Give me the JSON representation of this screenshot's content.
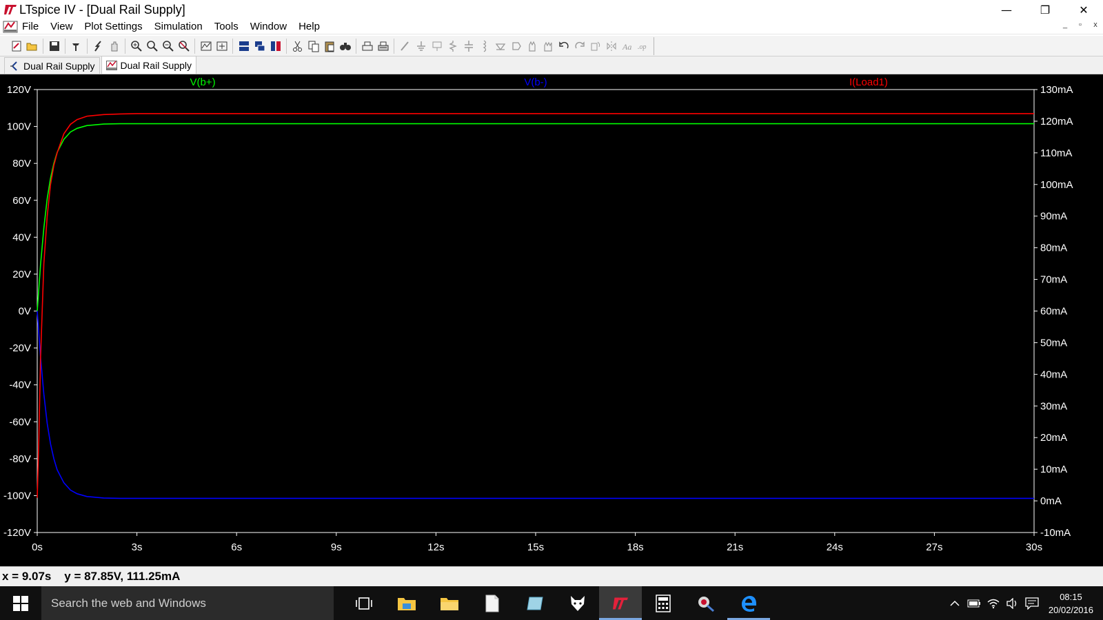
{
  "window": {
    "title": "LTspice IV - [Dual Rail Supply]",
    "controls": {
      "minimize": "—",
      "maximize": "❐",
      "close": "✕"
    }
  },
  "menu": {
    "items": [
      "File",
      "View",
      "Plot Settings",
      "Simulation",
      "Tools",
      "Window",
      "Help"
    ],
    "mdi": {
      "minimize": "_",
      "restore": "▫",
      "close": "x"
    }
  },
  "toolbar": {
    "groups": [
      [
        "new-schematic-icon",
        "open-icon"
      ],
      [
        "save-icon"
      ],
      [
        "control-panel-icon"
      ],
      [
        "run-icon",
        "halt-icon"
      ],
      [
        "zoom-in-icon",
        "zoom-area-icon",
        "zoom-out-icon",
        "zoom-fit-icon"
      ],
      [
        "autorange-icon",
        "add-trace-icon"
      ],
      [
        "tile-horizontal-icon",
        "cascade-icon",
        "tile-vertical-icon"
      ],
      [
        "cut-icon",
        "copy-icon",
        "paste-icon",
        "find-icon"
      ],
      [
        "print-icon",
        "print-preview-icon"
      ],
      [
        "wire-icon",
        "ground-icon",
        "label-icon",
        "resistor-icon",
        "capacitor-icon",
        "inductor-icon",
        "diode-icon",
        "component-icon",
        "move-icon",
        "drag-icon",
        "undo-icon",
        "redo-icon",
        "rotate-icon",
        "mirror-icon",
        "text-icon",
        "spice-directive-icon"
      ]
    ]
  },
  "tabs": [
    {
      "label": "Dual Rail Supply",
      "kind": "schematic",
      "active": false
    },
    {
      "label": "Dual Rail Supply",
      "kind": "waveform",
      "active": true
    }
  ],
  "plot": {
    "background": "#000000",
    "traces": [
      {
        "label": "V(b+)",
        "color": "#00ff00"
      },
      {
        "label": "V(b-)",
        "color": "#0000ff"
      },
      {
        "label": "I(Load1)",
        "color": "#ff0000"
      }
    ]
  },
  "chart_data": {
    "type": "line",
    "x": {
      "label": "",
      "range": [
        0,
        30
      ],
      "ticks": [
        "0s",
        "3s",
        "6s",
        "9s",
        "12s",
        "15s",
        "18s",
        "21s",
        "24s",
        "27s",
        "30s"
      ]
    },
    "y_left": {
      "label": "",
      "range": [
        -120,
        120
      ],
      "ticks": [
        "120V",
        "100V",
        "80V",
        "60V",
        "40V",
        "20V",
        "0V",
        "-20V",
        "-40V",
        "-60V",
        "-80V",
        "-100V",
        "-120V"
      ]
    },
    "y_right": {
      "label": "",
      "range": [
        -10,
        130
      ],
      "ticks": [
        "130mA",
        "120mA",
        "110mA",
        "100mA",
        "90mA",
        "80mA",
        "70mA",
        "60mA",
        "50mA",
        "40mA",
        "30mA",
        "20mA",
        "10mA",
        "0mA",
        "-10mA"
      ]
    },
    "series": [
      {
        "name": "V(b+)",
        "axis": "left",
        "color": "#00ff00",
        "x": [
          0,
          0.1,
          0.2,
          0.3,
          0.4,
          0.5,
          0.6,
          0.8,
          1.0,
          1.2,
          1.5,
          2.0,
          2.5,
          3,
          30
        ],
        "y": [
          0,
          25,
          45,
          61,
          72,
          80,
          86,
          93,
          97,
          99,
          100.5,
          101.3,
          101.5,
          101.5,
          101.5
        ]
      },
      {
        "name": "V(b-)",
        "axis": "left",
        "color": "#0000ff",
        "x": [
          0,
          0.1,
          0.2,
          0.3,
          0.4,
          0.5,
          0.6,
          0.8,
          1.0,
          1.2,
          1.5,
          2.0,
          2.5,
          3,
          30
        ],
        "y": [
          0,
          -25,
          -45,
          -61,
          -72,
          -80,
          -86,
          -93,
          -97,
          -99,
          -100.5,
          -101.3,
          -101.5,
          -101.5,
          -101.5
        ]
      },
      {
        "name": "I(Load1)",
        "axis": "right",
        "color": "#ff0000",
        "x": [
          0,
          0.05,
          0.1,
          0.2,
          0.3,
          0.4,
          0.5,
          0.6,
          0.8,
          1.0,
          1.2,
          1.5,
          2.0,
          2.5,
          3,
          30
        ],
        "y": [
          1,
          20,
          45,
          75,
          90,
          100,
          106,
          110,
          116,
          119,
          120.5,
          121.6,
          122.1,
          122.3,
          122.4,
          122.4
        ]
      }
    ],
    "grid": false
  },
  "status": {
    "cursor_readout": "x = 9.07s    y = 87.85V, 111.25mA"
  },
  "taskbar": {
    "search_placeholder": "Search the web and Windows",
    "apps": [
      "task-view-icon",
      "file-explorer-icon",
      "folder-icon",
      "document-icon",
      "notepad-icon",
      "fox-app-icon",
      "ltspice-icon",
      "calculator-icon",
      "tools-app-icon",
      "edge-icon"
    ],
    "clock": {
      "time": "08:15",
      "date": "20/02/2016"
    }
  }
}
